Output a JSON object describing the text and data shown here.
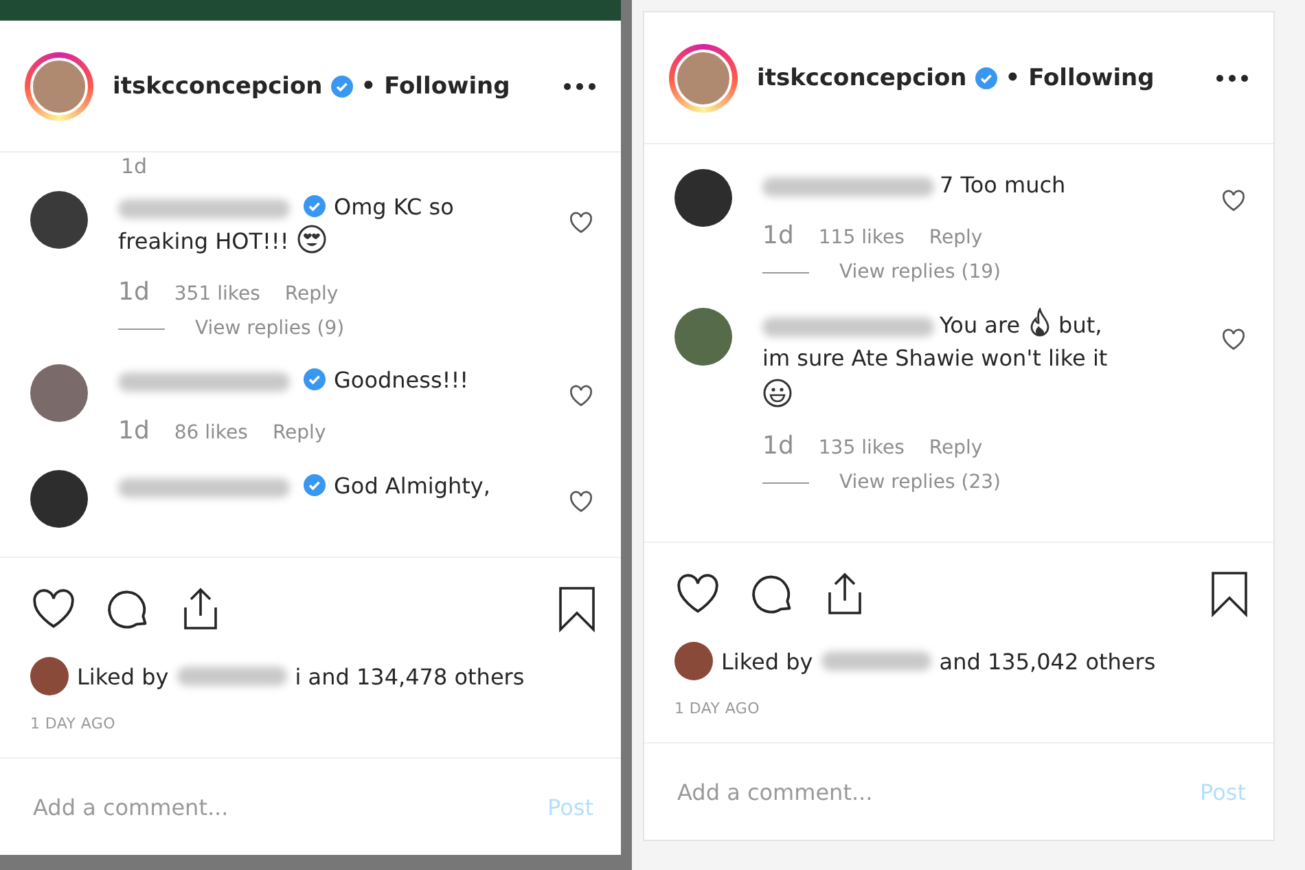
{
  "panels": [
    {
      "username": "itskcconcepcion",
      "verified": true,
      "following": "• Following",
      "leading_time": "1d",
      "comments": [
        {
          "verified": true,
          "segments": [
            {
              "kind": "text",
              "text": "Omg KC so"
            },
            {
              "kind": "break"
            },
            {
              "kind": "text",
              "text": "freaking HOT!!!"
            },
            {
              "kind": "heart_eyes"
            }
          ],
          "time": "1d",
          "likes": "351 likes",
          "reply": "Reply",
          "view_replies": "View replies (9)"
        },
        {
          "verified": true,
          "segments": [
            {
              "kind": "text",
              "text": "Goodness!!!"
            }
          ],
          "time": "1d",
          "likes": "86 likes",
          "reply": "Reply"
        },
        {
          "verified": true,
          "segments": [
            {
              "kind": "text",
              "text": "God Almighty,"
            }
          ]
        }
      ],
      "liked_tail": "i and 134,478 others",
      "liked_prefix": "Liked by",
      "ago": "1 DAY AGO",
      "placeholder": "Add a comment...",
      "post": "Post"
    },
    {
      "username": "itskcconcepcion",
      "verified": true,
      "following": "• Following",
      "comments": [
        {
          "verified": false,
          "segments": [
            {
              "kind": "text",
              "text": "7 Too much"
            }
          ],
          "time": "1d",
          "likes": "115 likes",
          "reply": "Reply",
          "view_replies": "View replies (19)"
        },
        {
          "verified": false,
          "segments": [
            {
              "kind": "text",
              "text": "You are"
            },
            {
              "kind": "fire"
            },
            {
              "kind": "text",
              "text": "but,"
            },
            {
              "kind": "break"
            },
            {
              "kind": "text",
              "text": "im sure Ate Shawie won't like it"
            },
            {
              "kind": "break"
            },
            {
              "kind": "grin"
            }
          ],
          "time": "1d",
          "likes": "135 likes",
          "reply": "Reply",
          "view_replies": "View replies (23)"
        }
      ],
      "liked_tail": "and 135,042 others",
      "liked_prefix": "Liked by",
      "ago": "1 DAY AGO",
      "placeholder": "Add a comment...",
      "post": "Post"
    }
  ]
}
